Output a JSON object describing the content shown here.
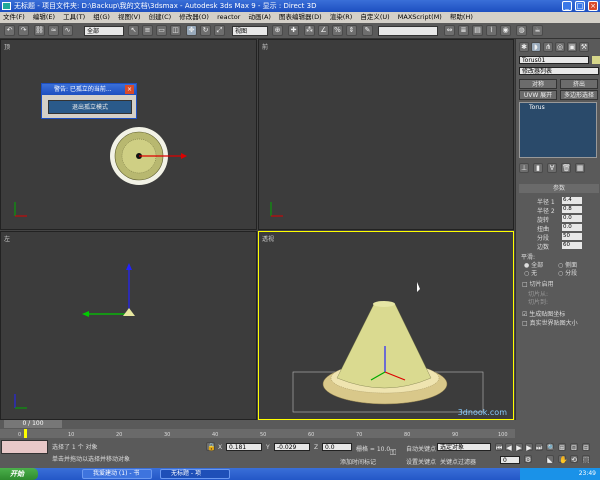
{
  "window": {
    "title": "无标题    - 项目文件夹: D:\\Backup\\我的文档\\3dsmax    - Autodesk 3ds Max 9    - 显示 : Direct 3D"
  },
  "menu": [
    "文件(F)",
    "编辑(E)",
    "工具(T)",
    "组(G)",
    "视图(V)",
    "创建(C)",
    "修改器(O)",
    "reactor",
    "动画(A)",
    "图表编辑器(D)",
    "渲染(R)",
    "自定义(U)",
    "MAXScript(M)",
    "帮助(H)"
  ],
  "toolbar": {
    "selection_filter": "全部",
    "ref_coord": "视图"
  },
  "viewports": {
    "top": "顶",
    "front": "前",
    "left": "左",
    "persp": "透视"
  },
  "dialog": {
    "title": "警告: 已孤立的当前...",
    "button": "退出孤立模式"
  },
  "command_panel": {
    "object_name": "Torus01",
    "modifier_list": "修改器列表",
    "btn_apply": "对称",
    "btn_extrude": "挤出",
    "btn_uvw": "UVW 展开",
    "btn_multi": "多边形选择",
    "stack_item": "Torus",
    "rollout_title": "参数",
    "params": [
      {
        "label": "半径 1",
        "value": "6.4"
      },
      {
        "label": "半径 2",
        "value": "0.8"
      },
      {
        "label": "旋转",
        "value": "0.0"
      },
      {
        "label": "扭曲",
        "value": "0.0"
      },
      {
        "label": "分段",
        "value": "50"
      },
      {
        "label": "边数",
        "value": "60"
      }
    ],
    "smooth": {
      "title": "平滑:",
      "all": "全部",
      "side": "侧面",
      "none": "无",
      "segment": "分段"
    },
    "slice_on": "切片启用",
    "slice_from": "切片从:",
    "slice_to": "切片到:",
    "gen_map": "生成贴图坐标",
    "real_world": "真实世界贴图大小"
  },
  "bottom": {
    "time": "0 / 100",
    "ticks": [
      "0",
      "10",
      "20",
      "30",
      "40",
      "50",
      "60",
      "70",
      "80",
      "90",
      "100"
    ],
    "status_sel": "选择了 1 个 对象",
    "prompt": "单击并拖动以选择并移动对象",
    "x_label": "X",
    "x_val": "0.181",
    "y_label": "Y",
    "y_val": "-0.029",
    "z_label": "Z",
    "z_val": "0.0",
    "grid": "栅格 = 10.0",
    "add_tag": "添加时间标记",
    "auto_key": "自动关键点",
    "sel_obj": "选定对象",
    "set_key": "设置关键点",
    "key_filter": "关键点过滤器",
    "frame": "0",
    "watermark": "3dnook.com"
  },
  "taskbar": {
    "start": "开始",
    "task1": "我爱建动 (1) - 书",
    "task2": "无标题 - 项",
    "clock": "23:49"
  },
  "colors": {
    "accent": "#d4d0c8",
    "torus": "#d6d68a",
    "cone": "#dada90"
  }
}
